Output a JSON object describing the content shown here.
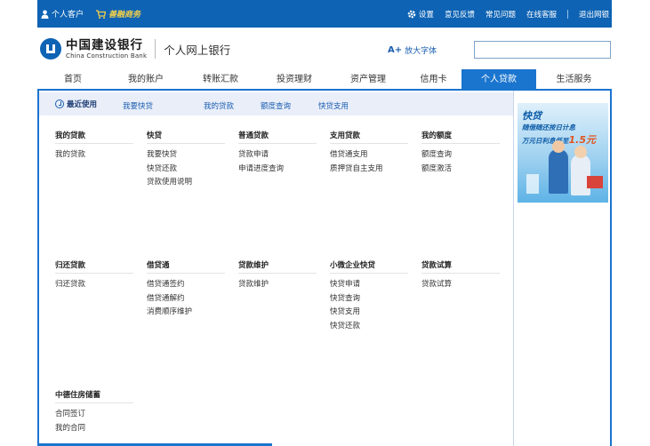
{
  "topbar": {
    "personal_customer": "个人客户",
    "shanrong": "善融商务",
    "settings": "设置",
    "feedback": "意见反馈",
    "faq": "常见问题",
    "online_service": "在线客服",
    "logout": "退出网银"
  },
  "header": {
    "bank_cn": "中国建设银行",
    "bank_en": "China Construction Bank",
    "product": "个人网上银行",
    "enlarge_prefix": "A+",
    "enlarge": "放大字体",
    "search_value": ""
  },
  "nav": {
    "tabs": [
      {
        "label": "首页"
      },
      {
        "label": "我的账户"
      },
      {
        "label": "转账汇款"
      },
      {
        "label": "投资理财"
      },
      {
        "label": "资产管理"
      },
      {
        "label": "信用卡"
      },
      {
        "label": "个人贷款",
        "active": true
      },
      {
        "label": "生活服务"
      }
    ]
  },
  "subbar": {
    "recent": "最近使用",
    "links": [
      "我要快贷",
      "我的贷款",
      "额度查询",
      "快贷支用"
    ]
  },
  "ad": {
    "title": "快贷",
    "line1": "随借随还按日计息",
    "line2_prefix": "万元日利息低至",
    "line2_value": "1.5元"
  },
  "categories": [
    {
      "title": "我的贷款",
      "links": [
        "我的贷款"
      ]
    },
    {
      "title": "快贷",
      "links": [
        "我要快贷",
        "快贷还款",
        "贷款使用说明"
      ]
    },
    {
      "title": "普通贷款",
      "links": [
        "贷款申请",
        "申请进度查询"
      ]
    },
    {
      "title": "支用贷款",
      "links": [
        "借贷通支用",
        "质押贷自主支用"
      ]
    },
    {
      "title": "我的额度",
      "links": [
        "额度查询",
        "额度激活"
      ]
    },
    {
      "title": "归还贷款",
      "links": [
        "归还贷款"
      ]
    },
    {
      "title": "借贷通",
      "links": [
        "借贷通签约",
        "借贷通解约",
        "消费顺序维护"
      ]
    },
    {
      "title": "贷款维护",
      "links": [
        "贷款维护"
      ]
    },
    {
      "title": "小微企业快贷",
      "links": [
        "快贷申请",
        "快贷查询",
        "快贷支用",
        "快贷还款"
      ]
    },
    {
      "title": "贷款试算",
      "links": [
        "贷款试算"
      ]
    },
    {
      "title": "中德住房储蓄",
      "links": [
        "合同签订",
        "我的合同"
      ]
    }
  ]
}
